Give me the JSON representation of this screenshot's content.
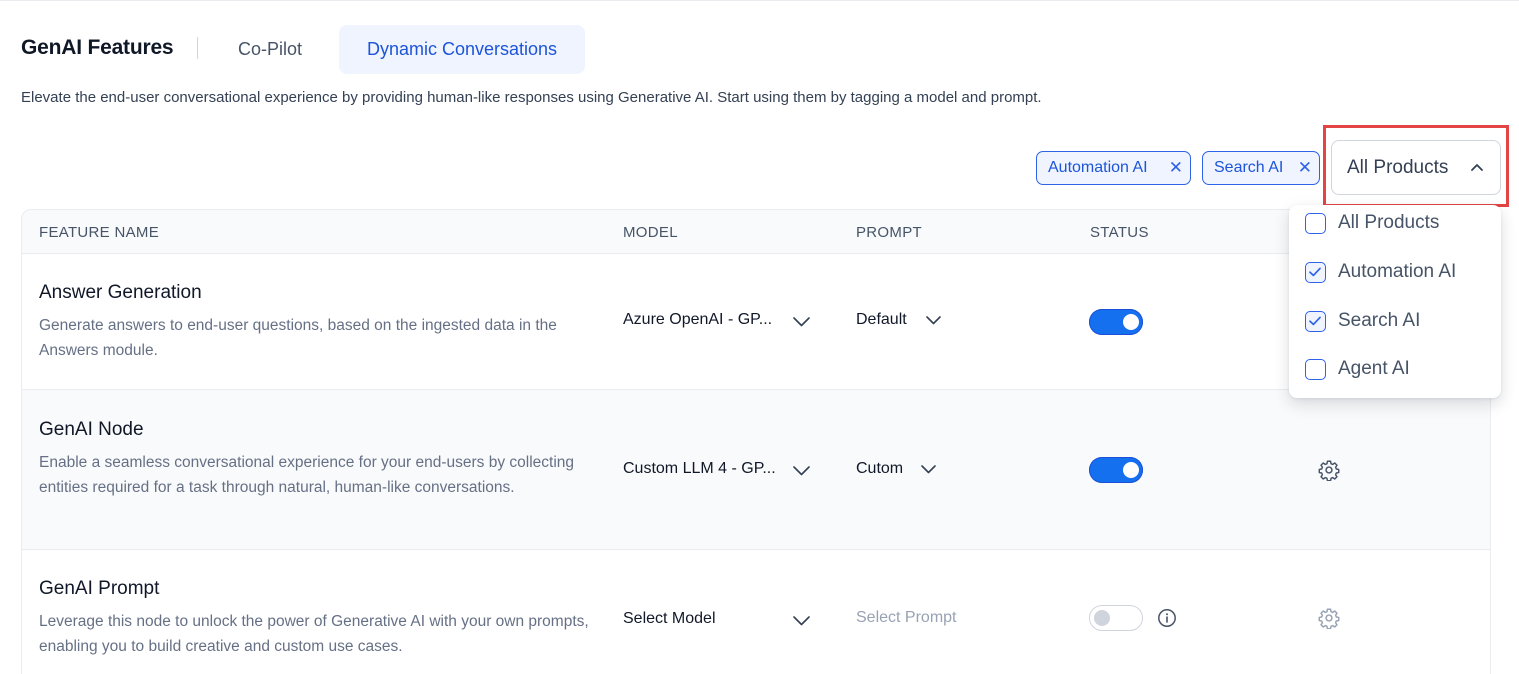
{
  "header": {
    "title": "GenAI Features",
    "tabs": [
      {
        "label": "Co-Pilot",
        "active": false
      },
      {
        "label": "Dynamic Conversations",
        "active": true
      }
    ],
    "description": "Elevate the end-user conversational experience by providing human-like responses using Generative AI. Start using them by tagging a model and prompt."
  },
  "filters": {
    "chips": [
      {
        "label": "Automation AI",
        "remove_icon": "close-icon"
      },
      {
        "label": "Search AI",
        "remove_icon": "close-icon"
      }
    ],
    "dropdown": {
      "value": "All Products",
      "open": true,
      "options": [
        {
          "label": "All Products",
          "checked": false
        },
        {
          "label": "Automation AI",
          "checked": true
        },
        {
          "label": "Search AI",
          "checked": true
        },
        {
          "label": "Agent AI",
          "checked": false
        }
      ]
    }
  },
  "table": {
    "columns": [
      "FEATURE NAME",
      "MODEL",
      "PROMPT",
      "STATUS"
    ],
    "rows": [
      {
        "name": "Answer Generation",
        "description": "Generate answers to end-user questions, based on the ingested data in the Answers module.",
        "model": "Azure OpenAI - GP...",
        "prompt": "Default",
        "status_on": true,
        "settings_icon": "none"
      },
      {
        "name": "GenAI Node",
        "description": "Enable a seamless conversational experience for your end-users by collecting entities required for a task through natural, human-like conversations.",
        "model": "Custom LLM 4 - GP...",
        "prompt": "Cutom",
        "status_on": true,
        "settings_icon": "gear-icon"
      },
      {
        "name": "GenAI Prompt",
        "description": "Leverage this node to unlock the power of Generative AI with your own prompts, enabling you to build creative and custom use cases.",
        "model": "Select Model",
        "prompt": "Select Prompt",
        "status_on": false,
        "settings_icon": "gear-icon"
      }
    ]
  },
  "colors": {
    "accent": "#1570ef",
    "accent_text": "#1d54d9",
    "chip_bg": "#eff4ff",
    "highlight_border": "#e34444"
  }
}
